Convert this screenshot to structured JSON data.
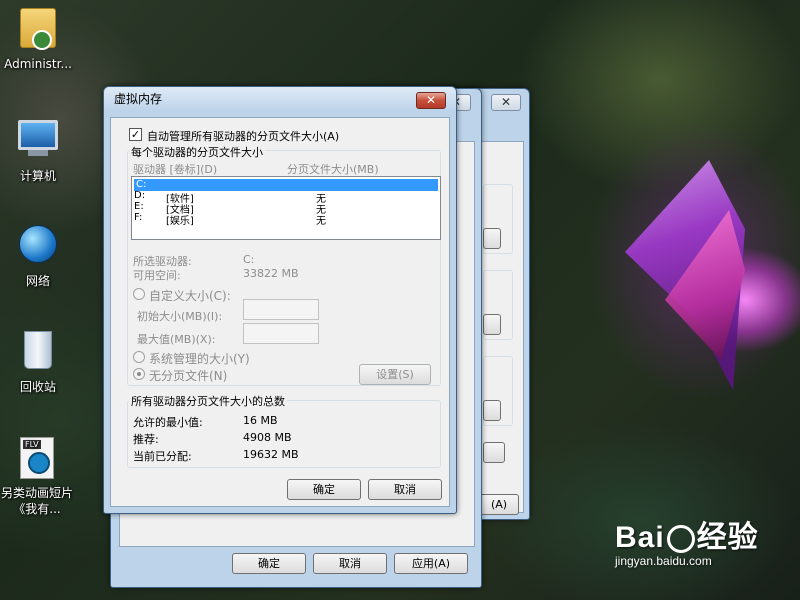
{
  "desktop": {
    "icons": [
      {
        "label": "Administr...",
        "icon": "user-folder-icon"
      },
      {
        "label": "计算机",
        "icon": "computer-icon"
      },
      {
        "label": "网络",
        "icon": "network-icon"
      },
      {
        "label": "回收站",
        "icon": "recycle-bin-icon"
      },
      {
        "label": "另类动画短片《我有...",
        "icon": "flv-video-icon"
      }
    ]
  },
  "back_window_1": {
    "close_label": "✕",
    "ok_label": "确定",
    "cancel_label": "取消",
    "apply_label": "应用(A)"
  },
  "back_window_2": {
    "close_label": "✕",
    "partial_button_label": "(A)"
  },
  "dialog": {
    "title": "虚拟内存",
    "close_label": "✕",
    "auto_manage_label": "自动管理所有驱动器的分页文件大小(A)",
    "auto_manage_checked": true,
    "per_drive_group_title": "每个驱动器的分页文件大小",
    "columns": [
      "驱动器 [卷标](D)",
      "分页文件大小(MB)"
    ],
    "drives": [
      {
        "drive": "C:",
        "label": "",
        "size": "",
        "selected": true
      },
      {
        "drive": "D:",
        "label": "[软件]",
        "size": "无",
        "selected": false
      },
      {
        "drive": "E:",
        "label": "[文档]",
        "size": "无",
        "selected": false
      },
      {
        "drive": "F:",
        "label": "[娱乐]",
        "size": "无",
        "selected": false
      }
    ],
    "selected_drive_label": "所选驱动器:",
    "selected_drive_value": "C:",
    "free_space_label": "可用空间:",
    "free_space_value": "33822 MB",
    "custom_size_label": "自定义大小(C):",
    "initial_size_label": "初始大小(MB)(I):",
    "max_size_label": "最大值(MB)(X):",
    "system_managed_label": "系统管理的大小(Y)",
    "no_paging_label": "无分页文件(N)",
    "set_button_label": "设置(S)",
    "total_group_title": "所有驱动器分页文件大小的总数",
    "min_allowed_label": "允许的最小值:",
    "min_allowed_value": "16 MB",
    "recommended_label": "推荐:",
    "recommended_value": "4908 MB",
    "allocated_label": "当前已分配:",
    "allocated_value": "19632 MB",
    "ok_label": "确定",
    "cancel_label": "取消"
  },
  "watermark": {
    "brand_left": "Bai",
    "brand_right": "经验",
    "url": "jingyan.baidu.com"
  },
  "colors": {
    "selection": "#3399ff",
    "window_frame": "#bcd3ea",
    "close_red": "#c74f3c"
  }
}
